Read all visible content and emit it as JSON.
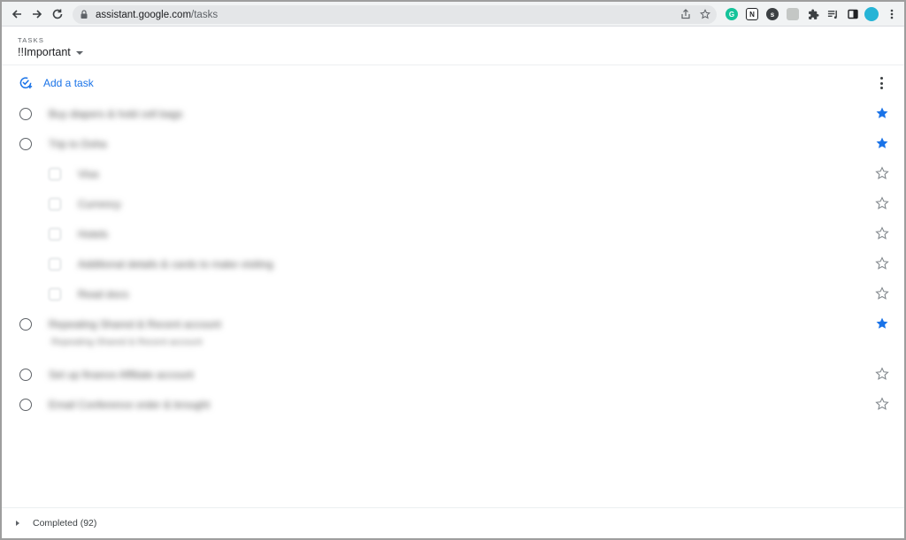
{
  "browser": {
    "url_domain": "assistant.google.com",
    "url_path": "/tasks"
  },
  "header": {
    "section_label": "TASKS",
    "list_name": "!!Important"
  },
  "actions": {
    "add_task_label": "Add a task"
  },
  "tasks": [
    {
      "title": "Buy diapers & hold cell bags",
      "starred": true,
      "subtask": false
    },
    {
      "title": "Trip to Doha",
      "starred": true,
      "subtask": false
    },
    {
      "title": "Visa",
      "starred": false,
      "subtask": true
    },
    {
      "title": "Currency",
      "starred": false,
      "subtask": true
    },
    {
      "title": "Hotels",
      "starred": false,
      "subtask": true
    },
    {
      "title": "Additional details & cards to make visiting",
      "starred": false,
      "subtask": true
    },
    {
      "title": "Read docs",
      "starred": false,
      "subtask": true
    },
    {
      "title": "Repeating Shared & Recent account",
      "starred": true,
      "subtask": false,
      "detail": "Repeating Shared & Recent account"
    },
    {
      "title": "Set up finance Affiliate account",
      "starred": false,
      "subtask": false
    },
    {
      "title": "Email Conference order & brought",
      "starred": false,
      "subtask": false
    }
  ],
  "footer": {
    "completed_label": "Completed (92)"
  },
  "colors": {
    "accent": "#1a73e8",
    "star_filled": "#1a73e8",
    "star_empty": "#80868b"
  }
}
